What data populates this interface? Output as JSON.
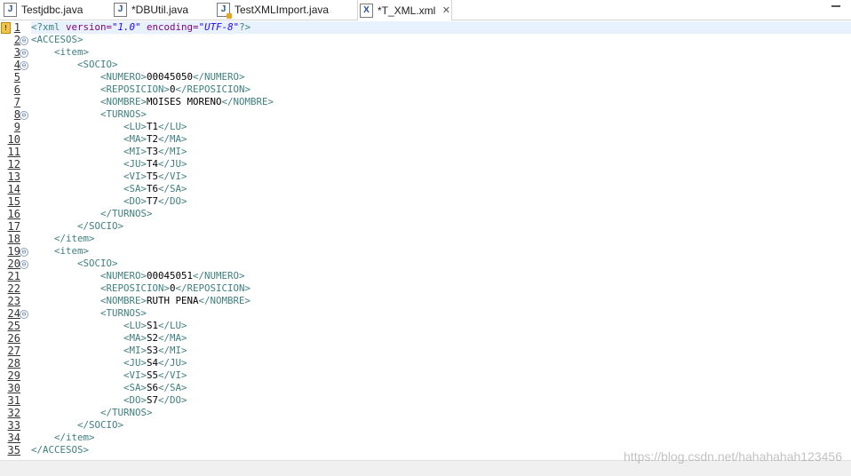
{
  "tabs": [
    {
      "label": "Testjdbc.java",
      "icon": "java-file-icon",
      "glyph": "J",
      "warn": false,
      "active": false
    },
    {
      "label": "*DBUtil.java",
      "icon": "java-file-icon",
      "glyph": "J",
      "warn": false,
      "active": false
    },
    {
      "label": "TestXMLImport.java",
      "icon": "java-file-icon",
      "glyph": "J",
      "warn": true,
      "active": false
    },
    {
      "label": "*T_XML.xml",
      "icon": "xml-file-icon",
      "glyph": "X",
      "warn": false,
      "active": true
    }
  ],
  "tab_close_glyph": "✕",
  "editor": {
    "lines": [
      [
        {
          "t": "<?xml ",
          "c": "pi"
        },
        {
          "t": "version=",
          "c": "attr"
        },
        {
          "t": "\"1.0\"",
          "c": "val"
        },
        {
          "t": " encoding=",
          "c": "attr"
        },
        {
          "t": "\"UTF-8\"",
          "c": "val"
        },
        {
          "t": "?>",
          "c": "pi"
        }
      ],
      [
        {
          "t": "<ACCESOS>",
          "c": "tag"
        }
      ],
      [
        {
          "t": "    <item>",
          "c": "tag"
        }
      ],
      [
        {
          "t": "        <SOCIO>",
          "c": "tag"
        }
      ],
      [
        {
          "t": "            <NUMERO>",
          "c": "tag"
        },
        {
          "t": "00045050",
          "c": "txt"
        },
        {
          "t": "</NUMERO>",
          "c": "tag"
        }
      ],
      [
        {
          "t": "            <REPOSICION>",
          "c": "tag"
        },
        {
          "t": "0",
          "c": "txt"
        },
        {
          "t": "</REPOSICION>",
          "c": "tag"
        }
      ],
      [
        {
          "t": "            <NOMBRE>",
          "c": "tag"
        },
        {
          "t": "MOISES MORENO",
          "c": "txt"
        },
        {
          "t": "</NOMBRE>",
          "c": "tag"
        }
      ],
      [
        {
          "t": "            <TURNOS>",
          "c": "tag"
        }
      ],
      [
        {
          "t": "                <LU>",
          "c": "tag"
        },
        {
          "t": "T1",
          "c": "txt"
        },
        {
          "t": "</LU>",
          "c": "tag"
        }
      ],
      [
        {
          "t": "                <MA>",
          "c": "tag"
        },
        {
          "t": "T2",
          "c": "txt"
        },
        {
          "t": "</MA>",
          "c": "tag"
        }
      ],
      [
        {
          "t": "                <MI>",
          "c": "tag"
        },
        {
          "t": "T3",
          "c": "txt"
        },
        {
          "t": "</MI>",
          "c": "tag"
        }
      ],
      [
        {
          "t": "                <JU>",
          "c": "tag"
        },
        {
          "t": "T4",
          "c": "txt"
        },
        {
          "t": "</JU>",
          "c": "tag"
        }
      ],
      [
        {
          "t": "                <VI>",
          "c": "tag"
        },
        {
          "t": "T5",
          "c": "txt"
        },
        {
          "t": "</VI>",
          "c": "tag"
        }
      ],
      [
        {
          "t": "                <SA>",
          "c": "tag"
        },
        {
          "t": "T6",
          "c": "txt"
        },
        {
          "t": "</SA>",
          "c": "tag"
        }
      ],
      [
        {
          "t": "                <DO>",
          "c": "tag"
        },
        {
          "t": "T7",
          "c": "txt"
        },
        {
          "t": "</DO>",
          "c": "tag"
        }
      ],
      [
        {
          "t": "            </TURNOS>",
          "c": "tag"
        }
      ],
      [
        {
          "t": "        </SOCIO>",
          "c": "tag"
        }
      ],
      [
        {
          "t": "    </item>",
          "c": "tag"
        }
      ],
      [
        {
          "t": "    <item>",
          "c": "tag"
        }
      ],
      [
        {
          "t": "        <SOCIO>",
          "c": "tag"
        }
      ],
      [
        {
          "t": "            <NUMERO>",
          "c": "tag"
        },
        {
          "t": "00045051",
          "c": "txt"
        },
        {
          "t": "</NUMERO>",
          "c": "tag"
        }
      ],
      [
        {
          "t": "            <REPOSICION>",
          "c": "tag"
        },
        {
          "t": "0",
          "c": "txt"
        },
        {
          "t": "</REPOSICION>",
          "c": "tag"
        }
      ],
      [
        {
          "t": "            <NOMBRE>",
          "c": "tag"
        },
        {
          "t": "RUTH PENA",
          "c": "txt"
        },
        {
          "t": "</NOMBRE>",
          "c": "tag"
        }
      ],
      [
        {
          "t": "            <TURNOS>",
          "c": "tag"
        }
      ],
      [
        {
          "t": "                <LU>",
          "c": "tag"
        },
        {
          "t": "S1",
          "c": "txt"
        },
        {
          "t": "</LU>",
          "c": "tag"
        }
      ],
      [
        {
          "t": "                <MA>",
          "c": "tag"
        },
        {
          "t": "S2",
          "c": "txt"
        },
        {
          "t": "</MA>",
          "c": "tag"
        }
      ],
      [
        {
          "t": "                <MI>",
          "c": "tag"
        },
        {
          "t": "S3",
          "c": "txt"
        },
        {
          "t": "</MI>",
          "c": "tag"
        }
      ],
      [
        {
          "t": "                <JU>",
          "c": "tag"
        },
        {
          "t": "S4",
          "c": "txt"
        },
        {
          "t": "</JU>",
          "c": "tag"
        }
      ],
      [
        {
          "t": "                <VI>",
          "c": "tag"
        },
        {
          "t": "S5",
          "c": "txt"
        },
        {
          "t": "</VI>",
          "c": "tag"
        }
      ],
      [
        {
          "t": "                <SA>",
          "c": "tag"
        },
        {
          "t": "S6",
          "c": "txt"
        },
        {
          "t": "</SA>",
          "c": "tag"
        }
      ],
      [
        {
          "t": "                <DO>",
          "c": "tag"
        },
        {
          "t": "S7",
          "c": "txt"
        },
        {
          "t": "</DO>",
          "c": "tag"
        }
      ],
      [
        {
          "t": "            </TURNOS>",
          "c": "tag"
        }
      ],
      [
        {
          "t": "        </SOCIO>",
          "c": "tag"
        }
      ],
      [
        {
          "t": "    </item>",
          "c": "tag"
        }
      ],
      [
        {
          "t": "</ACCESOS>",
          "c": "tag"
        }
      ]
    ],
    "line_numbers": [
      "1",
      "2",
      "3",
      "4",
      "5",
      "6",
      "7",
      "8",
      "9",
      "10",
      "11",
      "12",
      "13",
      "14",
      "15",
      "16",
      "17",
      "18",
      "19",
      "20",
      "21",
      "22",
      "23",
      "24",
      "25",
      "26",
      "27",
      "28",
      "29",
      "30",
      "31",
      "32",
      "33",
      "34",
      "35"
    ],
    "fold_lines": [
      2,
      3,
      4,
      8,
      19,
      20,
      24
    ],
    "warning_line": 1,
    "current_line": 1
  },
  "fold_glyph": "⊖",
  "warning_glyph": "!",
  "watermark": "https://blog.csdn.net/hahahahah123456",
  "colors": {
    "tag": "#3f7f7f",
    "attribute": "#7f007f",
    "value": "#2a00ff",
    "text": "#000000",
    "current_line": "#e8f2fe"
  }
}
